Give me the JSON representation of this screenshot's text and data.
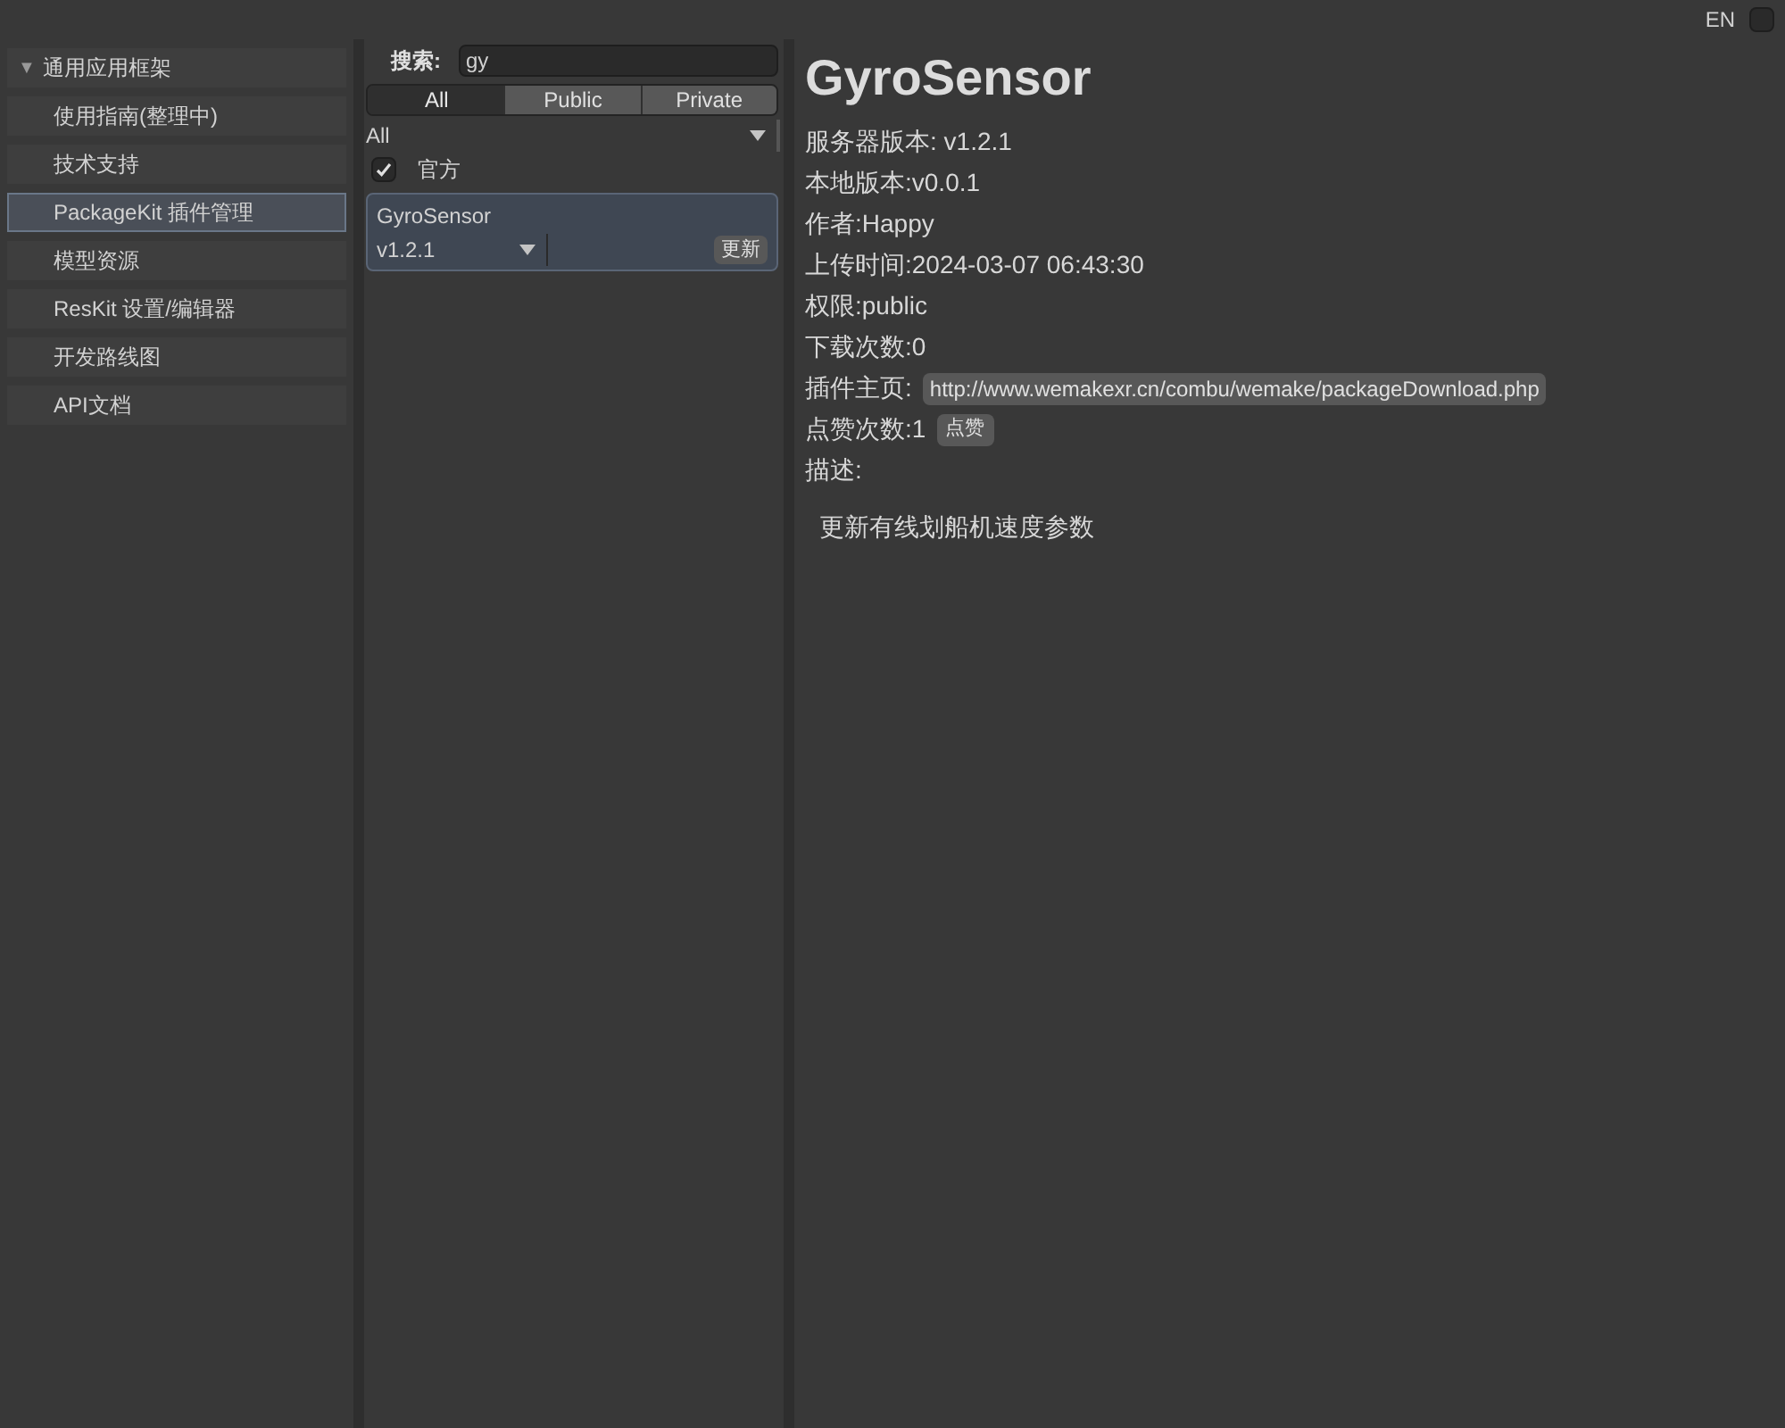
{
  "top_bar": {
    "language": "EN",
    "checked": false
  },
  "sidebar": {
    "group": {
      "label": "通用应用框架",
      "expanded": true,
      "icon": "▼"
    },
    "items": [
      {
        "label": "使用指南(整理中)",
        "selected": false
      },
      {
        "label": "技术支持",
        "selected": false
      },
      {
        "label": "PackageKit 插件管理",
        "selected": true
      },
      {
        "label": "模型资源",
        "selected": false
      },
      {
        "label": "ResKit 设置/编辑器",
        "selected": false
      },
      {
        "label": "开发路线图",
        "selected": false
      },
      {
        "label": "API文档",
        "selected": false
      }
    ]
  },
  "package_list": {
    "search": {
      "label": "搜索:",
      "value": "gy"
    },
    "tabs": [
      {
        "label": "All",
        "selected": true
      },
      {
        "label": "Public",
        "selected": false
      },
      {
        "label": "Private",
        "selected": false
      }
    ],
    "filter": {
      "value": "All"
    },
    "official": {
      "label": "官方",
      "checked": true
    },
    "packages": [
      {
        "name": "GyroSensor",
        "version": "v1.2.1",
        "action": "更新",
        "selected": true
      }
    ]
  },
  "details": {
    "title": "GyroSensor",
    "lines": [
      "服务器版本: v1.2.1",
      "本地版本:v0.0.1",
      "作者:Happy",
      "上传时间:2024-03-07 06:43:30",
      "权限:public",
      "下载次数:0"
    ],
    "homepage": {
      "label": "插件主页:",
      "url": "http://www.wemakexr.cn/combu/wemake/packageDownload.php"
    },
    "likes": {
      "label": "点赞次数:1",
      "button": "点赞"
    },
    "description_label": "描述:",
    "description": "更新有线划船机速度参数"
  }
}
